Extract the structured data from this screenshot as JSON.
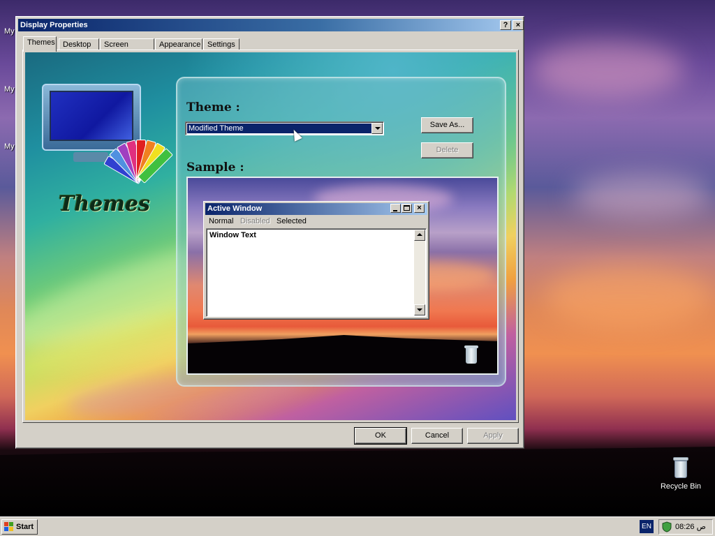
{
  "desktop": {
    "left_labels": [
      "My",
      "My",
      "My"
    ],
    "recycle_bin_label": "Recycle Bin"
  },
  "dialog": {
    "title": "Display Properties",
    "help_button": "?",
    "close_button": "×",
    "tabs": [
      {
        "label": "Themes",
        "active": true
      },
      {
        "label": "Desktop",
        "active": false
      },
      {
        "label": "Screen Saver",
        "active": false
      },
      {
        "label": "Appearance",
        "active": false
      },
      {
        "label": "Settings",
        "active": false
      }
    ],
    "logo_text": "Themes",
    "theme_label": "Theme :",
    "theme_value": "Modified Theme",
    "save_as_label": "Save As...",
    "delete_label": "Delete",
    "sample_label": "Sample :",
    "sample_window": {
      "title": "Active Window",
      "menu": [
        "Normal",
        "Disabled",
        "Selected"
      ],
      "text": "Window Text"
    },
    "ok_label": "OK",
    "cancel_label": "Cancel",
    "apply_label": "Apply"
  },
  "taskbar": {
    "start_label": "Start",
    "language": "EN",
    "clock": "08:26 ص"
  },
  "colors": {
    "title_active": "#0a246a",
    "title_gradient_end": "#a6caf0",
    "face": "#d4d0c8"
  }
}
